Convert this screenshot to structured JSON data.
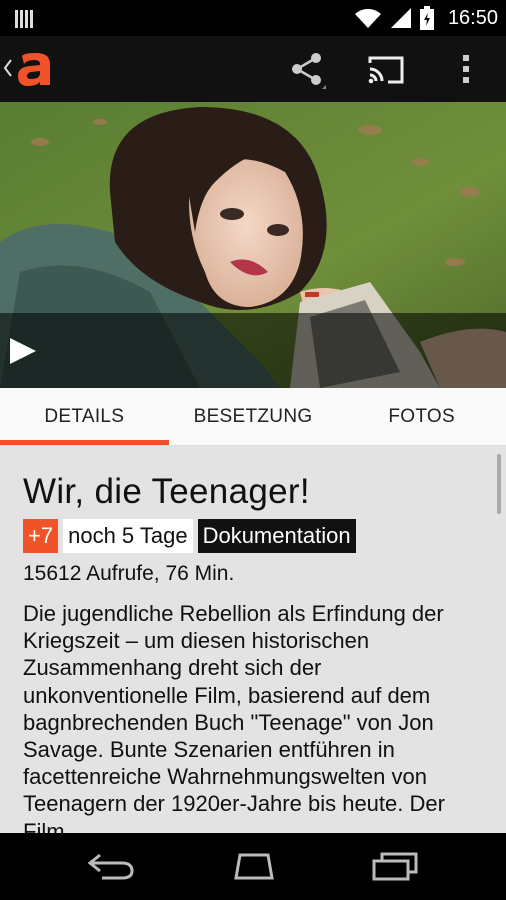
{
  "status_bar": {
    "time": "16:50",
    "icons": [
      "notification-bars-icon",
      "wifi-icon",
      "signal-icon",
      "battery-icon"
    ]
  },
  "app_bar": {
    "logo_text": "a",
    "actions": [
      "share-icon",
      "cast-icon",
      "more-vert-icon"
    ]
  },
  "tabs": [
    {
      "label": "DETAILS",
      "active": true
    },
    {
      "label": "BESETZUNG",
      "active": false
    },
    {
      "label": "FOTOS",
      "active": false
    }
  ],
  "details": {
    "title": "Wir, die Teenager!",
    "age_badge": "+7",
    "availability": "noch 5 Tage",
    "genre": "Dokumentation",
    "meta": "15612 Aufrufe, 76 Min.",
    "description": "Die jugendliche Rebellion als Erfindung der Kriegszeit – um diesen historischen Zusammenhang dreht sich der unkonventionelle Film, basierend auf dem bagnbrechenden Buch \"Teenage\" von Jon Savage. Bunte Szenarien entführen in facettenreiche Wahrnehmungswelten von Teenagern der 1920er-Jahre bis heute. Der Film"
  },
  "colors": {
    "accent": "#f0532a",
    "app_bar": "#111111",
    "content_bg": "#e3e3e3"
  },
  "nav_bar": [
    "back-icon",
    "home-icon",
    "recents-icon"
  ]
}
